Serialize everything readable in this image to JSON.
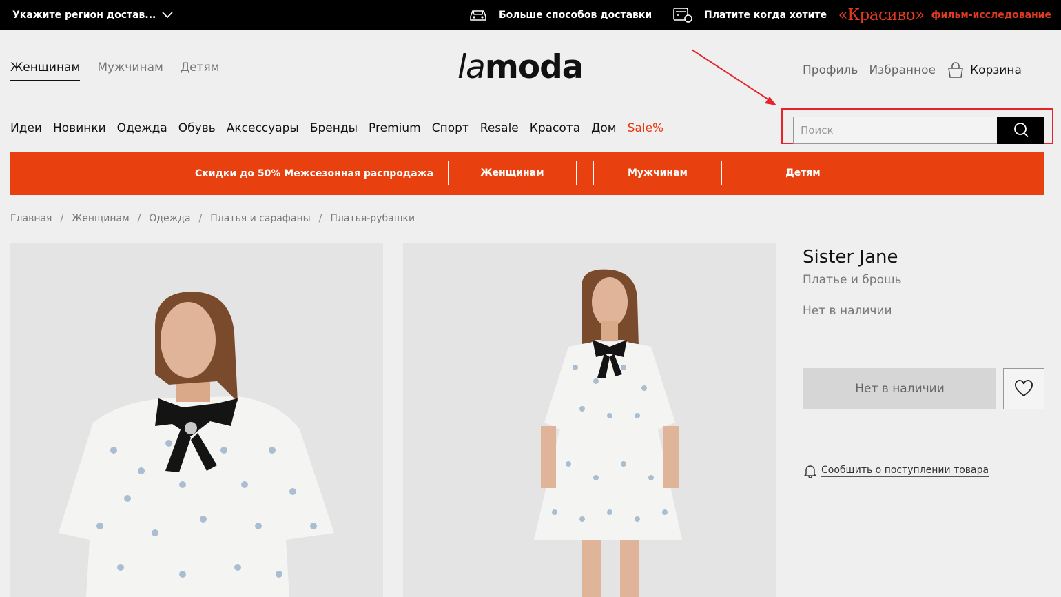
{
  "topbar": {
    "region": "Укажите регион достав...",
    "delivery": "Больше способов доставки",
    "payment": "Платите когда хотите",
    "promo_brand": "«Красиво»",
    "promo_film": "фильм-исследование"
  },
  "header": {
    "logo": "lamoda",
    "logo_la": "la",
    "logo_rest": "moda",
    "gender_tabs": [
      "Женщинам",
      "Мужчинам",
      "Детям"
    ],
    "active_gender": "Женщинам",
    "profile": "Профиль",
    "favorites": "Избранное",
    "cart": "Корзина"
  },
  "categories": [
    "Идеи",
    "Новинки",
    "Одежда",
    "Обувь",
    "Аксессуары",
    "Бренды",
    "Premium",
    "Спорт",
    "Resale",
    "Красота",
    "Дом",
    "Sale%"
  ],
  "search": {
    "placeholder": "Поиск"
  },
  "banner": {
    "text": "Скидки до 50% Межсезонная распродажа",
    "buttons": [
      "Женщинам",
      "Мужчинам",
      "Детям"
    ]
  },
  "breadcrumb": [
    "Главная",
    "Женщинам",
    "Одежда",
    "Платья и сарафаны",
    "Платья-рубашки"
  ],
  "product": {
    "brand": "Sister Jane",
    "name": "Платье и брошь",
    "availability": "Нет в наличии",
    "button_label": "Нет в наличии",
    "notify_link": "Сообщить о поступлении товара"
  },
  "colors": {
    "accent_orange": "#e8410f",
    "sale_red": "#e8380d",
    "annotation_red": "#e3242b",
    "topbar_bg": "#000000"
  }
}
